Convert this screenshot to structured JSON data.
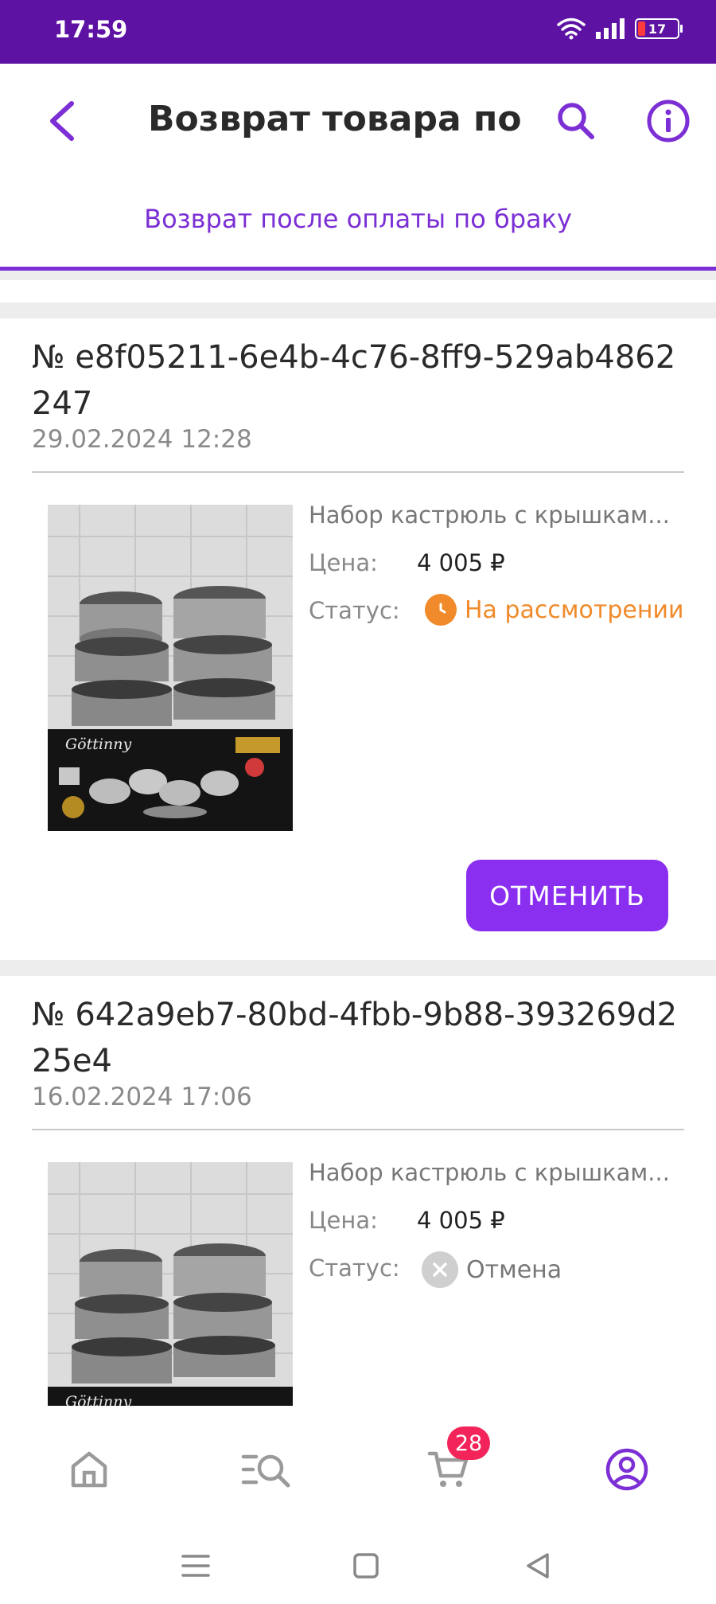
{
  "status_bar": {
    "time": "17:59",
    "battery": "17"
  },
  "header": {
    "title": "Возврат товара по бр",
    "tab": "Возврат после оплаты по браку"
  },
  "colors": {
    "accent": "#7b2fd4",
    "status_bar": "#5e12a3",
    "pending": "#f08a2a",
    "badge": "#f2245a"
  },
  "orders": [
    {
      "number": "№ e8f05211-6e4b-4c76-8ff9-529ab4862247",
      "date": "29.02.2024 12:28",
      "product": "Набор кастрюль с крышкам...",
      "price_label": "Цена:",
      "price": "4 005 ₽",
      "status_label": "Статус:",
      "status": "На рассмотрении",
      "status_icon": "clock-icon",
      "brand": "Göttinny",
      "cancel_label": "ОТМЕНИТЬ"
    },
    {
      "number": "№ 642a9eb7-80bd-4fbb-9b88-393269d225e4",
      "date": "16.02.2024 17:06",
      "product": "Набор кастрюль с крышкам...",
      "price_label": "Цена:",
      "price": "4 005 ₽",
      "status_label": "Статус:",
      "status": "Отмена",
      "status_icon": "x-circle-icon",
      "brand": "Göttinny"
    }
  ],
  "bottom_nav": {
    "items": [
      "home-icon",
      "catalog-search-icon",
      "cart-icon",
      "profile-icon"
    ],
    "cart_badge": "28",
    "active": "profile-icon"
  },
  "system_nav": [
    "menu-icon",
    "home-square-icon",
    "back-triangle-icon"
  ]
}
